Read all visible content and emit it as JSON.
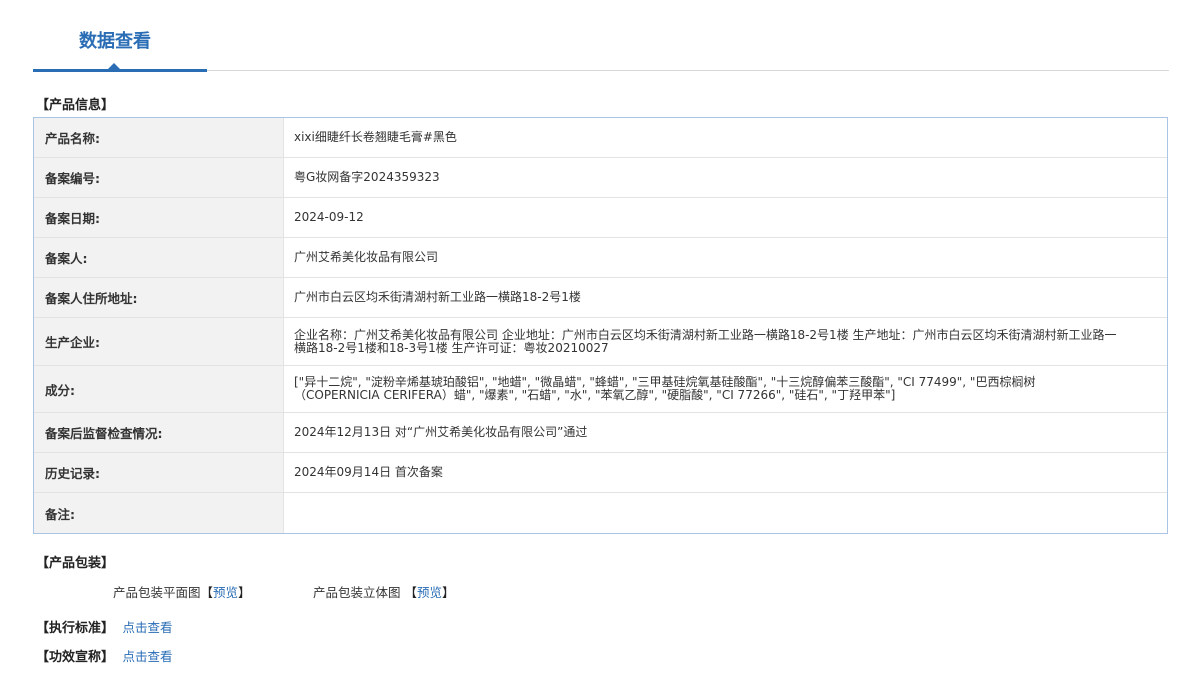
{
  "tab": {
    "label": "数据查看"
  },
  "sections": {
    "product_info": "【产品信息】",
    "packaging": "【产品包装】",
    "standard": "【执行标准】",
    "efficacy": "【功效宣称】"
  },
  "rows": [
    {
      "key": "产品名称:",
      "value": "xixi细睫纤长卷翘睫毛膏#黑色"
    },
    {
      "key": "备案编号:",
      "value": "粤G妆网备字2024359323"
    },
    {
      "key": "备案日期:",
      "value": "2024-09-12"
    },
    {
      "key": "备案人:",
      "value": "广州艾希美化妆品有限公司"
    },
    {
      "key": "备案人住所地址:",
      "value": "广州市白云区均禾街清湖村新工业路一横路18-2号1楼"
    },
    {
      "key": "生产企业:",
      "value": "企业名称：广州艾希美化妆品有限公司 企业地址：广州市白云区均禾街清湖村新工业路一横路18-2号1楼 生产地址：广州市白云区均禾街清湖村新工业路一横路18-2号1楼和18-3号1楼 生产许可证：粤妆20210027"
    },
    {
      "key": "成分:",
      "value": "[\"异十二烷\", \"淀粉辛烯基琥珀酸铝\", \"地蜡\", \"微晶蜡\", \"蜂蜡\", \"三甲基硅烷氧基硅酸酯\", \"十三烷醇偏苯三酸酯\", \"CI 77499\", \"巴西棕榈树（COPERNICIA CERIFERA）蜡\", \"爆素\", \"石蜡\", \"水\", \"苯氧乙醇\", \"硬脂酸\", \"CI 77266\", \"硅石\", \"丁羟甲苯\"]"
    },
    {
      "key": "备案后监督检查情况:",
      "value": "2024年12月13日 对“广州艾希美化妆品有限公司”通过"
    },
    {
      "key": "历史记录:",
      "value": "2024年09月14日 首次备案"
    },
    {
      "key": "备注:",
      "value": ""
    }
  ],
  "packaging": {
    "flat_label": "产品包装平面图",
    "three_d_label": "产品包装立体图",
    "preview_label": "预览",
    "open_bracket": "【",
    "close_bracket": "】"
  },
  "links": {
    "standard_link": "点击查看",
    "efficacy_link": "点击查看"
  },
  "colors": {
    "accent": "#2a6db5",
    "table_border": "#a9c4e4",
    "label_bg": "#f2f2f2"
  }
}
